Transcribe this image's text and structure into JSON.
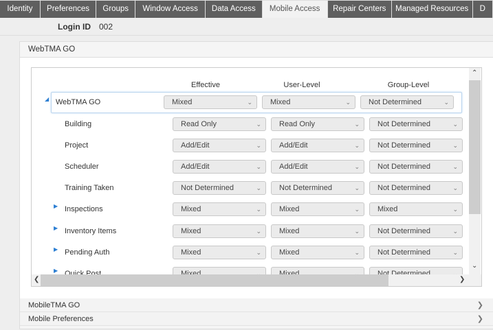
{
  "tabs": [
    {
      "label": "Identity"
    },
    {
      "label": "Preferences"
    },
    {
      "label": "Groups"
    },
    {
      "label": "Window Access"
    },
    {
      "label": "Data Access"
    },
    {
      "label": "Mobile Access"
    },
    {
      "label": "Repair Centers"
    },
    {
      "label": "Managed Resources"
    },
    {
      "label": "D"
    }
  ],
  "active_tab": "Mobile Access",
  "login": {
    "label": "Login ID",
    "value": "002"
  },
  "section": {
    "title": "WebTMA GO",
    "columns": [
      "Effective",
      "User-Level",
      "Group-Level"
    ],
    "rows": [
      {
        "name": "WebTMA GO",
        "expander": "expanded",
        "values": [
          "Mixed",
          "Mixed",
          "Not Determined"
        ]
      },
      {
        "name": "Building",
        "expander": "",
        "values": [
          "Read Only",
          "Read Only",
          "Not Determined"
        ]
      },
      {
        "name": "Project",
        "expander": "",
        "values": [
          "Add/Edit",
          "Add/Edit",
          "Not Determined"
        ]
      },
      {
        "name": "Scheduler",
        "expander": "",
        "values": [
          "Add/Edit",
          "Add/Edit",
          "Not Determined"
        ]
      },
      {
        "name": "Training Taken",
        "expander": "",
        "values": [
          "Not Determined",
          "Not Determined",
          "Not Determined"
        ]
      },
      {
        "name": "Inspections",
        "expander": "collapsed",
        "values": [
          "Mixed",
          "Mixed",
          "Mixed"
        ]
      },
      {
        "name": "Inventory Items",
        "expander": "collapsed",
        "values": [
          "Mixed",
          "Mixed",
          "Not Determined"
        ]
      },
      {
        "name": "Pending Auth",
        "expander": "collapsed",
        "values": [
          "Mixed",
          "Mixed",
          "Not Determined"
        ]
      },
      {
        "name": "Quick Post",
        "expander": "collapsed",
        "values": [
          "Mixed",
          "Mixed",
          "Not Determined"
        ]
      }
    ]
  },
  "accordions": [
    {
      "label": "MobileTMA GO"
    },
    {
      "label": "Mobile Preferences"
    }
  ]
}
